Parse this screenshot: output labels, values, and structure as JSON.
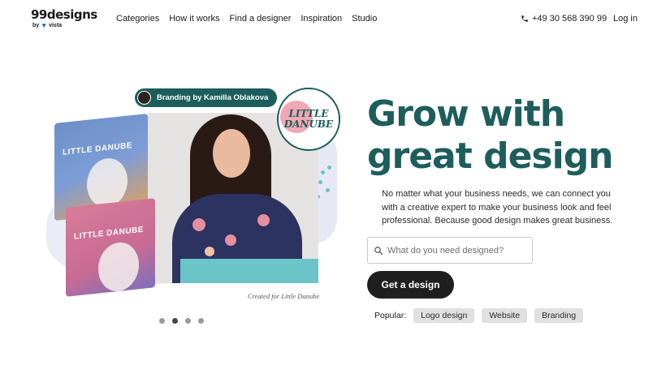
{
  "brand": {
    "name": "99designs",
    "sub_by": "by",
    "sub_vendor": "vista"
  },
  "nav": {
    "items": [
      {
        "label": "Categories"
      },
      {
        "label": "How it works"
      },
      {
        "label": "Find a designer"
      },
      {
        "label": "Inspiration"
      },
      {
        "label": "Studio"
      }
    ],
    "phone": "+49 30 568 390 99",
    "login": "Log in"
  },
  "hero": {
    "badge": "Branding by Kamilla Oblakova",
    "client_logo_line1": "LITTLE",
    "client_logo_line2": "DANUBE",
    "box_label_1": "LITTLE DANUBE",
    "box_label_2": "LITTLE DANUBE",
    "caption": "Created for Little Danube",
    "headline_line1": "Grow with",
    "headline_line2": "great design",
    "subtext": "No matter what your business needs, we can connect you with a creative expert to make your business look and feel professional. Because good design makes great business.",
    "search_placeholder": "What do you need designed?",
    "cta": "Get a design",
    "popular_label": "Popular:",
    "popular_tags": [
      {
        "label": "Logo design"
      },
      {
        "label": "Website"
      },
      {
        "label": "Branding"
      }
    ],
    "carousel": {
      "slides": 4,
      "active_index": 1
    }
  },
  "colors": {
    "accent": "#1d5e5c",
    "cta_bg": "#1f1f1f",
    "chip_bg": "#e0e0e0"
  },
  "icons": {
    "phone": "phone-icon",
    "search": "search-icon"
  }
}
